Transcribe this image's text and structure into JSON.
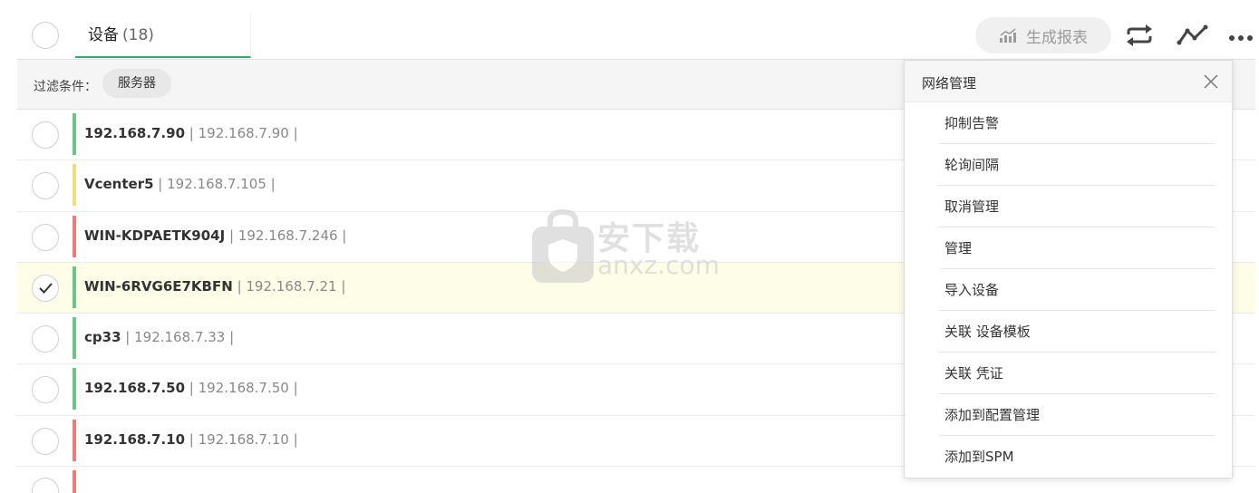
{
  "header": {
    "title": "设备",
    "count": "(18)",
    "report_button": "生成报表"
  },
  "filter": {
    "label": "过滤条件：",
    "chip": "服务器"
  },
  "rows": [
    {
      "name": "192.168.7.90",
      "ip": " | 192.168.7.90 |",
      "status_color": "#6cc38c",
      "selected": false
    },
    {
      "name": "Vcenter5",
      "ip": " | 192.168.7.105 |",
      "status_color": "#f0dc78",
      "selected": false
    },
    {
      "name": "WIN-KDPAETK904J",
      "ip": " | 192.168.7.246 |",
      "status_color": "#ef7b7b",
      "selected": false
    },
    {
      "name": "WIN-6RVG6E7KBFN",
      "ip": " | 192.168.7.21 |",
      "status_color": "#6cc38c",
      "selected": true
    },
    {
      "name": "cp33",
      "ip": " | 192.168.7.33 |",
      "status_color": "#6cc38c",
      "selected": false
    },
    {
      "name": "192.168.7.50",
      "ip": " | 192.168.7.50 |",
      "status_color": "#6cc38c",
      "selected": false
    },
    {
      "name": "192.168.7.10",
      "ip": " | 192.168.7.10 |",
      "status_color": "#ef7b7b",
      "selected": false
    }
  ],
  "menu": {
    "title": "网络管理",
    "items": [
      "抑制告警",
      "轮询间隔",
      "取消管理",
      "管理",
      "导入设备",
      "关联 设备模板",
      "关联 凭证",
      "添加到配置管理",
      "添加到SPM"
    ]
  },
  "watermark": {
    "cn": "安下载",
    "en": "anxz.com"
  },
  "icons": {
    "report": "chart-icon",
    "sync": "sync-icon",
    "trend": "trend-icon",
    "more": "more-icon",
    "close": "close-icon",
    "check": "check-icon"
  }
}
